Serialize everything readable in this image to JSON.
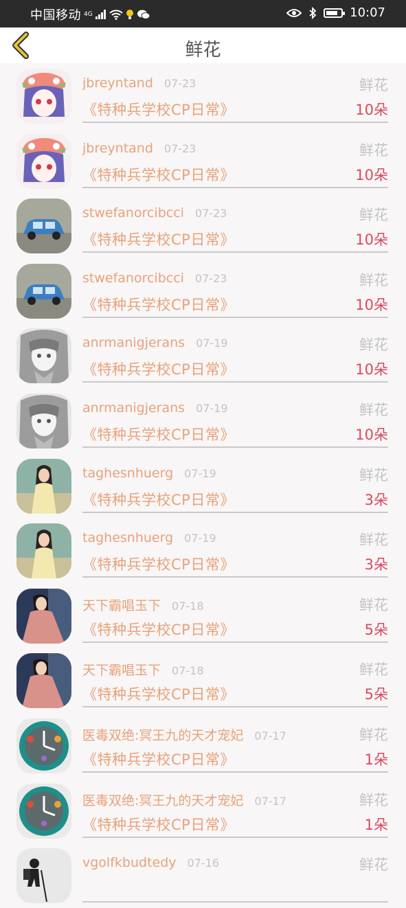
{
  "status_bar": {
    "carrier": "中国移动",
    "network": "4G",
    "time": "10:07",
    "battery_level": 0.7
  },
  "header": {
    "title": "鲜花"
  },
  "colors": {
    "name": "#e8a27a",
    "count": "#d84a5e",
    "muted": "#c4c4c4",
    "back_icon": "#d4a020"
  },
  "items": [
    {
      "name": "jbreyntand",
      "date": "07-23",
      "tag": "鲜花",
      "book": "《特种兵学校CP日常》",
      "count": "10朵",
      "avatar": "anime-girl-pink-hat"
    },
    {
      "name": "jbreyntand",
      "date": "07-23",
      "tag": "鲜花",
      "book": "《特种兵学校CP日常》",
      "count": "10朵",
      "avatar": "anime-girl-pink-hat"
    },
    {
      "name": "stwefanorcibcci",
      "date": "07-23",
      "tag": "鲜花",
      "book": "《特种兵学校CP日常》",
      "count": "10朵",
      "avatar": "blue-toy-car"
    },
    {
      "name": "stwefanorcibcci",
      "date": "07-23",
      "tag": "鲜花",
      "book": "《特种兵学校CP日常》",
      "count": "10朵",
      "avatar": "blue-toy-car"
    },
    {
      "name": "anrmanigjerans",
      "date": "07-19",
      "tag": "鲜花",
      "book": "《特种兵学校CP日常》",
      "count": "10朵",
      "avatar": "anime-girl-grayscale"
    },
    {
      "name": "anrmanigjerans",
      "date": "07-19",
      "tag": "鲜花",
      "book": "《特种兵学校CP日常》",
      "count": "10朵",
      "avatar": "anime-girl-grayscale"
    },
    {
      "name": "taghesnhuerg",
      "date": "07-19",
      "tag": "鲜花",
      "book": "《特种兵学校CP日常》",
      "count": "3朵",
      "avatar": "woman-outdoor"
    },
    {
      "name": "taghesnhuerg",
      "date": "07-19",
      "tag": "鲜花",
      "book": "《特种兵学校CP日常》",
      "count": "3朵",
      "avatar": "woman-outdoor"
    },
    {
      "name": "天下霸唱玉下",
      "date": "07-18",
      "tag": "鲜花",
      "book": "《特种兵学校CP日常》",
      "count": "5朵",
      "avatar": "woman-pink-dress"
    },
    {
      "name": "天下霸唱玉下",
      "date": "07-18",
      "tag": "鲜花",
      "book": "《特种兵学校CP日常》",
      "count": "5朵",
      "avatar": "woman-pink-dress"
    },
    {
      "name": "医毒双绝:冥王九的天才宠妃",
      "date": "07-17",
      "tag": "鲜花",
      "book": "《特种兵学校CP日常》",
      "count": "1朵",
      "avatar": "teal-clock"
    },
    {
      "name": "医毒双绝:冥王九的天才宠妃",
      "date": "07-17",
      "tag": "鲜花",
      "book": "《特种兵学校CP日常》",
      "count": "1朵",
      "avatar": "teal-clock"
    },
    {
      "name": "vgolfkbudtedy",
      "date": "07-16",
      "tag": "鲜花",
      "book": "",
      "count": "",
      "avatar": "hiker-silhouette"
    }
  ]
}
